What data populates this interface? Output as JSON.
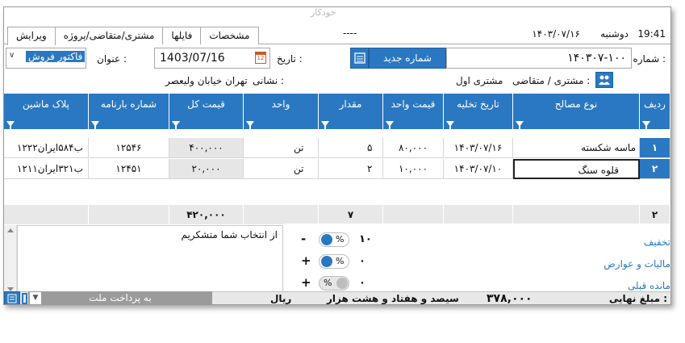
{
  "window": {
    "ghost_title": "خودکار"
  },
  "topbar": {
    "time": "19:41",
    "day": "دوشنبه",
    "date": "۱۴۰۳/۰۷/۱۶",
    "dashes": "----",
    "tabs": [
      "ویرایش",
      "مشتری/متقاضی/پروژه",
      "فایلها",
      "مشخصات"
    ]
  },
  "form": {
    "number_label": "شماره :",
    "number_value": "۱۴۰۳۰۷-۱۰۰",
    "new_number_button": "شماره جدید",
    "date_label": "تاریخ :",
    "date_value": "1403/07/16",
    "title_label": "عنوان :",
    "title_value": "فاکتور فروش",
    "customer_label": "مشتری / متقاضی :",
    "customer_value": "مشتری اول",
    "address_label": "نشانی :",
    "address_value": "تهران خیابان ولیعصر"
  },
  "grid": {
    "columns": [
      "ردیف",
      "نوع مصالح",
      "تاریخ تخلیه",
      "قیمت واحد",
      "مقدار",
      "واحد",
      "قیمت کل",
      "شماره بارنامه",
      "پلاک ماشین"
    ],
    "rows": [
      [
        "۱",
        "ماسه شکسته",
        "۱۴۰۳/۰۷/۱۶",
        "۸۰,۰۰۰",
        "۵",
        "تن",
        "۴۰۰,۰۰۰",
        "۱۲۵۴۶",
        "۱۲ب۵۸۴ایران۲۲"
      ],
      [
        "۲",
        "قلوه سنگ",
        "۱۴۰۳/۰۷/۱۰",
        "۱۰,۰۰۰",
        "۲",
        "تن",
        "۲۰,۰۰۰",
        "۱۲۴۵۱",
        "۱۲ب۳۲۱ایران۱۱"
      ]
    ],
    "footer": {
      "count": "۲",
      "qty_total": "۷",
      "price_total": "۴۲۰,۰۰۰"
    }
  },
  "notes": {
    "text": "از انتخاب شما متشکریم"
  },
  "adjustments": [
    {
      "label": "تخفیف",
      "sign": "-",
      "value": "۱۰",
      "pct_on": true
    },
    {
      "label": "مالیات و عوارض",
      "sign": "+",
      "value": "۰",
      "pct_on": true
    },
    {
      "label": "مانده قبلی",
      "sign": "+",
      "value": "۰",
      "pct_on": false
    }
  ],
  "pct_symbol": "%",
  "total": {
    "label": "مبلغ نهایی :",
    "value": "۳۷۸,۰۰۰",
    "words": "سیصد و هفتاد و هشت هزار",
    "currency": "ریال"
  },
  "payment": {
    "bank_value": "به پرداخت ملت"
  },
  "colors": {
    "accent": "#2a78c2",
    "footer_gray": "#e8e8e8"
  }
}
